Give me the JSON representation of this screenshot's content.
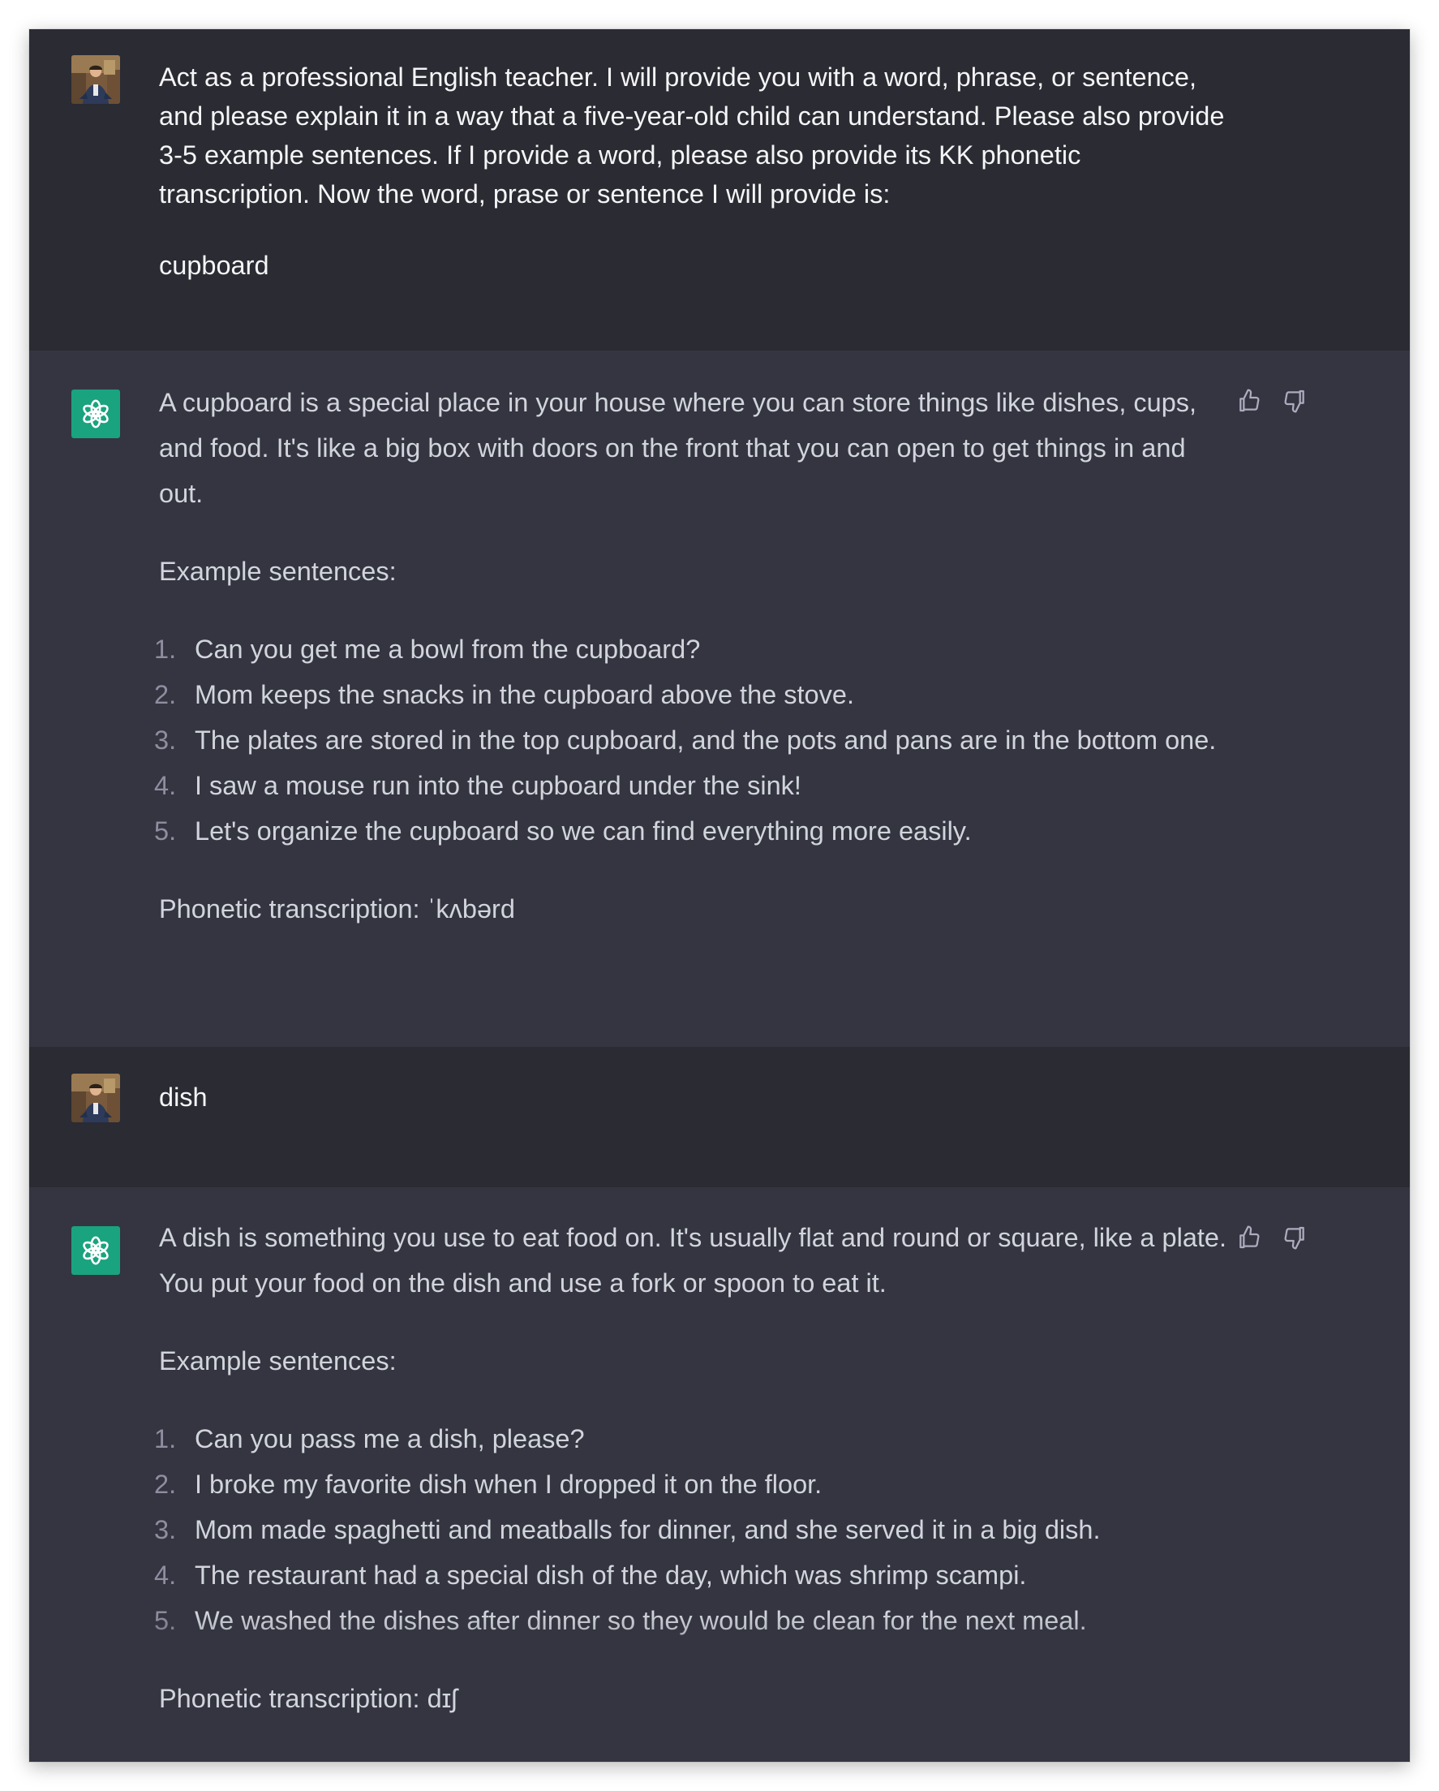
{
  "conversation": [
    {
      "role": "user",
      "paragraphs": [
        "Act as a professional English teacher. I will provide you with a word, phrase, or sentence, and please explain it in a way that a five-year-old child can understand. Please also provide 3-5 example sentences. If I provide a word, please also provide its KK phonetic transcription. Now the word, prase or sentence I will provide is:",
        "cupboard"
      ]
    },
    {
      "role": "assistant",
      "intro": "A cupboard is a special place in your house where you can store things like dishes, cups, and food. It's like a big box with doors on the front that you can open to get things in and out.",
      "examples_heading": "Example sentences:",
      "examples": [
        {
          "num": "1.",
          "text": "Can you get me a bowl from the cupboard?"
        },
        {
          "num": "2.",
          "text": "Mom keeps the snacks in the cupboard above the stove."
        },
        {
          "num": "3.",
          "text": "The plates are stored in the top cupboard, and the pots and pans are in the bottom one."
        },
        {
          "num": "4.",
          "text": "I saw a mouse run into the cupboard under the sink!"
        },
        {
          "num": "5.",
          "text": "Let's organize the cupboard so we can find everything more easily."
        }
      ],
      "phonetic": "Phonetic transcription: ˈkʌbərd"
    },
    {
      "role": "user",
      "paragraphs": [
        "dish"
      ]
    },
    {
      "role": "assistant",
      "intro": "A dish is something you use to eat food on. It's usually flat and round or square, like a plate. You put your food on the dish and use a fork or spoon to eat it.",
      "examples_heading": "Example sentences:",
      "examples": [
        {
          "num": "1.",
          "text": "Can you pass me a dish, please?"
        },
        {
          "num": "2.",
          "text": "I broke my favorite dish when I dropped it on the floor."
        },
        {
          "num": "3.",
          "text": "Mom made spaghetti and meatballs for dinner, and she served it in a big dish."
        },
        {
          "num": "4.",
          "text": "The restaurant had a special dish of the day, which was shrimp scampi."
        },
        {
          "num": "5.",
          "text": "We washed the dishes after dinner so they would be clean for the next meal."
        }
      ],
      "phonetic": "Phonetic transcription: dɪʃ"
    }
  ],
  "icons": {
    "assistant_avatar": "openai-logo-icon",
    "thumbs_up": "thumbs-up-icon",
    "thumbs_down": "thumbs-down-icon"
  },
  "colors": {
    "user_background": "#2a2b33",
    "assistant_background": "#343541",
    "assistant_avatar_background": "#19a37f",
    "text": "#d1d5db",
    "list_number": "#8e8ea0"
  }
}
